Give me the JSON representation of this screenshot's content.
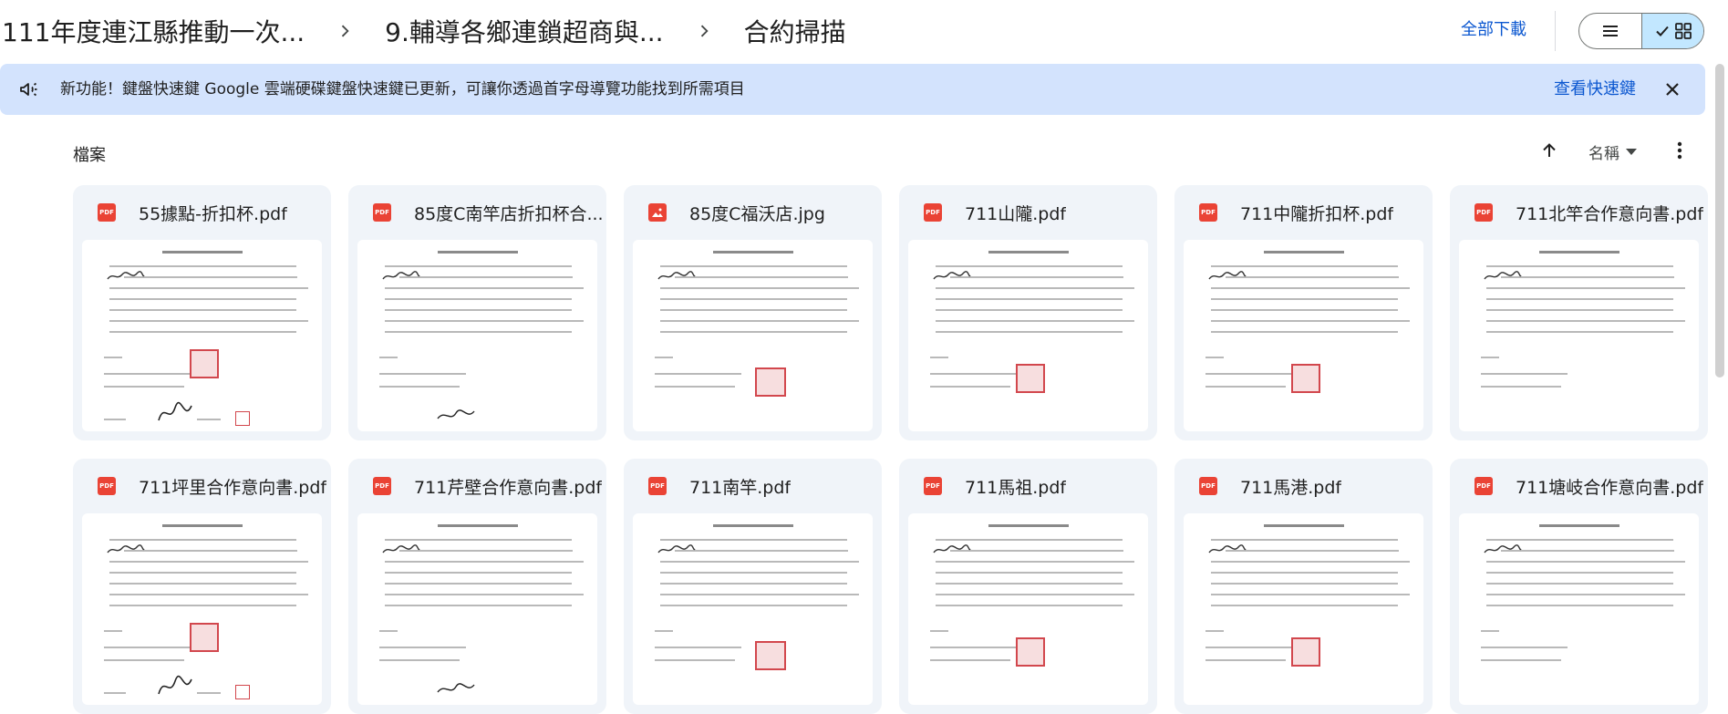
{
  "breadcrumb": [
    "111年度連江縣推動一次...",
    "9.輔導各鄉連鎖超商與...",
    "合約掃描"
  ],
  "header": {
    "download_all_label": "全部下載"
  },
  "banner": {
    "text": "新功能！鍵盤快速鍵 Google 雲端硬碟鍵盤快速鍵已更新，可讓你透過首字母導覽功能找到所需項目",
    "link_label": "查看快速鍵"
  },
  "files_section": {
    "label": "檔案",
    "sort_label": "名稱"
  },
  "files": [
    {
      "name": "55據點-折扣杯.pdf",
      "type": "pdf"
    },
    {
      "name": "85度C南竿店折扣杯合...",
      "type": "pdf"
    },
    {
      "name": "85度C福沃店.jpg",
      "type": "image"
    },
    {
      "name": "711山隴.pdf",
      "type": "pdf"
    },
    {
      "name": "711中隴折扣杯.pdf",
      "type": "pdf"
    },
    {
      "name": "711北竿合作意向書.pdf",
      "type": "pdf"
    },
    {
      "name": "711坪里合作意向書.pdf",
      "type": "pdf"
    },
    {
      "name": "711芹壁合作意向書.pdf",
      "type": "pdf"
    },
    {
      "name": "711南竿.pdf",
      "type": "pdf"
    },
    {
      "name": "711馬祖.pdf",
      "type": "pdf"
    },
    {
      "name": "711馬港.pdf",
      "type": "pdf"
    },
    {
      "name": "711塘岐合作意向書.pdf",
      "type": "pdf"
    }
  ],
  "icons": {
    "pdf_badge": "PDF",
    "file_type_pdf": "pdf-icon",
    "file_type_image": "image-icon"
  },
  "colors": {
    "accent_blue": "#0b57d0",
    "banner_bg": "#d3e3fd",
    "card_bg": "#f0f4f9",
    "toggle_selected": "#c2e7ff",
    "pdf_red": "#ea4335"
  }
}
